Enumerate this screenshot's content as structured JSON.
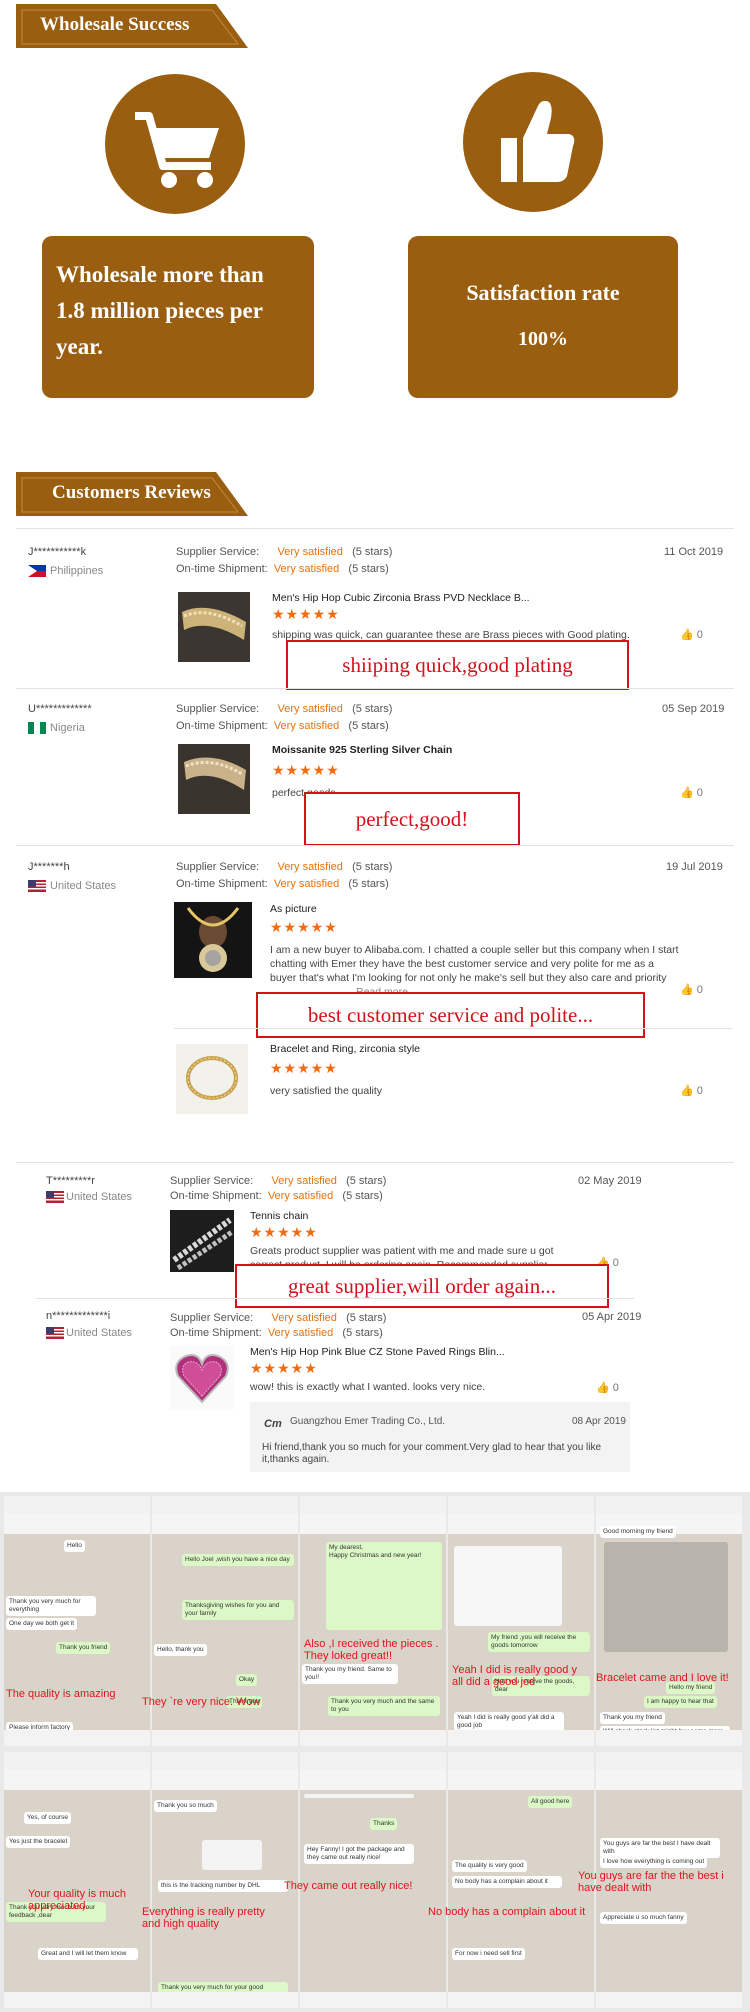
{
  "wholesale": {
    "banner": "Wholesale Success",
    "stat1": {
      "line1": "Wholesale more than",
      "line2": "1.8 million pieces per",
      "line3": "year."
    },
    "stat2": {
      "title": "Satisfaction rate",
      "value": "100%"
    },
    "icons": [
      "shopping-cart-icon",
      "thumbs-up-icon"
    ],
    "color": "#9a5e10"
  },
  "reviews": {
    "banner": "Customers Reviews",
    "supplier_label": "Supplier Service:",
    "shipment_label": "On-time Shipment:",
    "rating_value": "Very satisfied",
    "rating_stars": "(5 stars)",
    "star_glyphs": "★★★★★",
    "items": [
      {
        "user": "J***********k",
        "country": "Philippines",
        "date": "11 Oct 2019",
        "title": "Men's Hip Hop Cubic Zirconia Brass PVD Necklace B...",
        "comment": "shipping was quick, can guarantee these are Brass pieces with Good plating.",
        "likes": "0",
        "callout": "shiiping quick,good plating"
      },
      {
        "user": "U*************",
        "country": "Nigeria",
        "date": "05 Sep 2019",
        "title": "Moissanite 925 Sterling Silver Chain",
        "comment": "perfect goods",
        "likes": "0",
        "callout": "perfect,good!"
      },
      {
        "user": "J*******h",
        "country": "United States",
        "date": "19 Jul 2019",
        "title": "As picture",
        "comment": "I am a new buyer to Alibaba.com.  I chatted a couple seller but this company when I start chatting with Emer they have the best customer service and very polite for me as a buyer that's what I'm looking for not only he make's sell but they also care and priority",
        "read_more": "Read more",
        "likes": "0",
        "callout": "best customer service and polite...",
        "title2": "Bracelet and Ring, zirconia style",
        "comment2": "very satisfied the quality",
        "likes2": "0"
      },
      {
        "user": "T*********r",
        "country": "United States",
        "date": "02 May 2019",
        "title": "Tennis chain",
        "comment": "Greats product supplier was patient with me and made sure u got correct product. I will be ordering again. Recommended supplier",
        "likes": "0",
        "callout": "great supplier,will order again..."
      },
      {
        "user": "n*************i",
        "country": "United States",
        "date": "05 Apr 2019",
        "title": "Men's Hip Hop Pink Blue CZ Stone Paved Rings Blin...",
        "comment": "wow! this is exactly what I wanted. looks very nice.",
        "likes": "0"
      }
    ],
    "reply": {
      "company": "Guangzhou Emer Trading Co., Ltd.",
      "date": "08 Apr 2019",
      "text": "Hi friend,thank you so much for your comment.Very glad to hear that you like it,thanks again."
    }
  },
  "chats": {
    "row1": [
      {
        "annotation": "The quality is amazing"
      },
      {
        "annotation": "They `re very nice. Wow"
      },
      {
        "annotation": "Also ,I received the pieces . They loked great!!"
      },
      {
        "annotation": "Yeah I did is really good y all did a good jod"
      },
      {
        "annotation": "Bracelet came and I love it!"
      }
    ],
    "row2": [
      {
        "annotation": "Your quality is much appreciated."
      },
      {
        "annotation": "Everything is really pretty and high quality"
      },
      {
        "annotation": "They came out really nice!"
      },
      {
        "annotation": "No body has a complain about it"
      },
      {
        "annotation": "You guys are far the the best i have dealt with"
      }
    ],
    "bubbles": {
      "c1": [
        "Hello",
        "Thank you very much for everything",
        "One day we both get it",
        "Thank you friend",
        "Please inform factory"
      ],
      "c2": [
        "Hello Joel ,wish you have a nice day",
        "Thanksgiving wishes for you and your family",
        "Hello, thank you",
        "Okay",
        "Thank you"
      ],
      "c3": [
        "My dearest,",
        "Happy Christmas and new year!",
        "Thank you my friend. Same to you!!",
        "Thank you very much and the same to you"
      ],
      "c4": [
        "My friend ,you will receive the goods tomorrow",
        "Had you receive the goods, dear",
        "Yeah I did is really good y'all did a good job"
      ],
      "c5": [
        "Good morning my friend",
        "Hello my friend",
        "I am happy to hear that",
        "Thank you my friend",
        "Will check stock list might buy some more soon"
      ],
      "d1": [
        "Yes, of course",
        "Yes just the bracelet",
        "Thank you very much for your feedback ,dear",
        "Great and I will let them know"
      ],
      "d2": [
        "Thank you so much",
        "this is the tracking number by DHL",
        "Thank you very much for your good feedback!"
      ],
      "d3": [
        "Hey Fanny! I got the package and they came out really nice!",
        "Thanks"
      ],
      "d4": [
        "All good here",
        "The quality is very good",
        "No body has a complain about it",
        "For now i need sell first"
      ],
      "d5": [
        "You guys are far the best I have dealt with",
        "I love how everything is coming out",
        "Appreciate u so much fanny"
      ]
    }
  }
}
